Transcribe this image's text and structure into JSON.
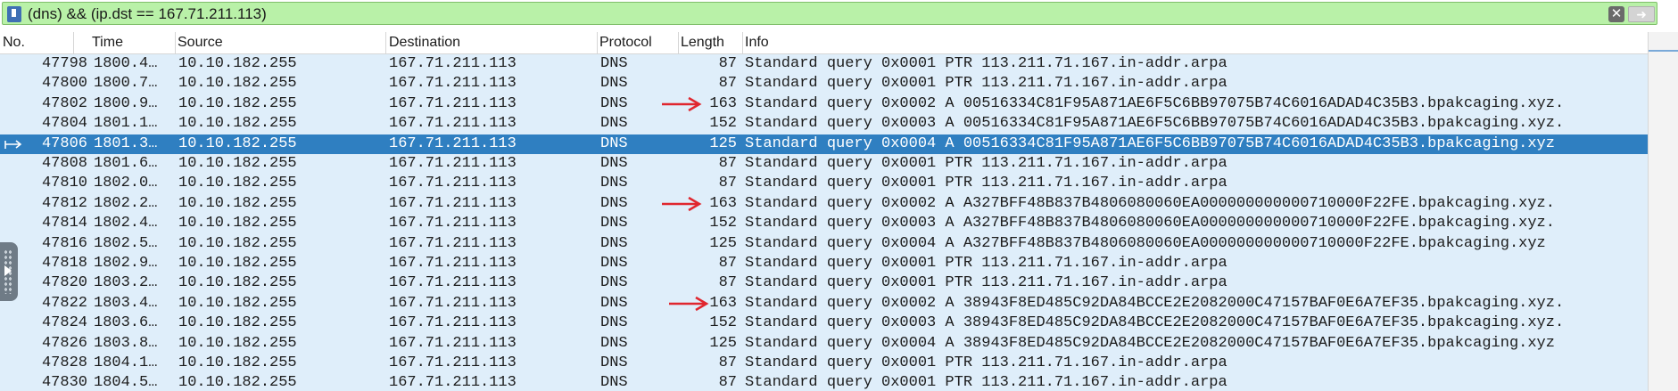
{
  "filter": {
    "expression": "(dns) && (ip.dst == 167.71.211.113)",
    "bookmark_icon": "bookmark-icon",
    "clear_icon": "clear-x-icon",
    "apply_icon": "apply-arrow-icon"
  },
  "columns": [
    "No.",
    "Time",
    "Source",
    "Destination",
    "Protocol",
    "Length",
    "Info"
  ],
  "packets": [
    {
      "no": "47798",
      "time": "1800.4…",
      "src": "10.10.182.255",
      "dst": "167.71.211.113",
      "proto": "DNS",
      "len": "87",
      "info": "Standard query 0x0001 PTR 113.211.71.167.in-addr.arpa"
    },
    {
      "no": "47800",
      "time": "1800.7…",
      "src": "10.10.182.255",
      "dst": "167.71.211.113",
      "proto": "DNS",
      "len": "87",
      "info": "Standard query 0x0001 PTR 113.211.71.167.in-addr.arpa"
    },
    {
      "no": "47802",
      "time": "1800.9…",
      "src": "10.10.182.255",
      "dst": "167.71.211.113",
      "proto": "DNS",
      "len": "163",
      "info": "Standard query 0x0002 A 00516334C81F95A871AE6F5C6BB97075B74C6016ADAD4C35B3.bpakcaging.xyz."
    },
    {
      "no": "47804",
      "time": "1801.1…",
      "src": "10.10.182.255",
      "dst": "167.71.211.113",
      "proto": "DNS",
      "len": "152",
      "info": "Standard query 0x0003 A 00516334C81F95A871AE6F5C6BB97075B74C6016ADAD4C35B3.bpakcaging.xyz."
    },
    {
      "no": "47806",
      "time": "1801.3…",
      "src": "10.10.182.255",
      "dst": "167.71.211.113",
      "proto": "DNS",
      "len": "125",
      "info": "Standard query 0x0004 A 00516334C81F95A871AE6F5C6BB97075B74C6016ADAD4C35B3.bpakcaging.xyz"
    },
    {
      "no": "47808",
      "time": "1801.6…",
      "src": "10.10.182.255",
      "dst": "167.71.211.113",
      "proto": "DNS",
      "len": "87",
      "info": "Standard query 0x0001 PTR 113.211.71.167.in-addr.arpa"
    },
    {
      "no": "47810",
      "time": "1802.0…",
      "src": "10.10.182.255",
      "dst": "167.71.211.113",
      "proto": "DNS",
      "len": "87",
      "info": "Standard query 0x0001 PTR 113.211.71.167.in-addr.arpa"
    },
    {
      "no": "47812",
      "time": "1802.2…",
      "src": "10.10.182.255",
      "dst": "167.71.211.113",
      "proto": "DNS",
      "len": "163",
      "info": "Standard query 0x0002 A A327BFF48B837B4806080060EA000000000000710000F22FE.bpakcaging.xyz."
    },
    {
      "no": "47814",
      "time": "1802.4…",
      "src": "10.10.182.255",
      "dst": "167.71.211.113",
      "proto": "DNS",
      "len": "152",
      "info": "Standard query 0x0003 A A327BFF48B837B4806080060EA000000000000710000F22FE.bpakcaging.xyz."
    },
    {
      "no": "47816",
      "time": "1802.5…",
      "src": "10.10.182.255",
      "dst": "167.71.211.113",
      "proto": "DNS",
      "len": "125",
      "info": "Standard query 0x0004 A A327BFF48B837B4806080060EA000000000000710000F22FE.bpakcaging.xyz"
    },
    {
      "no": "47818",
      "time": "1802.9…",
      "src": "10.10.182.255",
      "dst": "167.71.211.113",
      "proto": "DNS",
      "len": "87",
      "info": "Standard query 0x0001 PTR 113.211.71.167.in-addr.arpa"
    },
    {
      "no": "47820",
      "time": "1803.2…",
      "src": "10.10.182.255",
      "dst": "167.71.211.113",
      "proto": "DNS",
      "len": "87",
      "info": "Standard query 0x0001 PTR 113.211.71.167.in-addr.arpa"
    },
    {
      "no": "47822",
      "time": "1803.4…",
      "src": "10.10.182.255",
      "dst": "167.71.211.113",
      "proto": "DNS",
      "len": "163",
      "info": "Standard query 0x0002 A 38943F8ED485C92DA84BCCE2E2082000C47157BAF0E6A7EF35.bpakcaging.xyz."
    },
    {
      "no": "47824",
      "time": "1803.6…",
      "src": "10.10.182.255",
      "dst": "167.71.211.113",
      "proto": "DNS",
      "len": "152",
      "info": "Standard query 0x0003 A 38943F8ED485C92DA84BCCE2E2082000C47157BAF0E6A7EF35.bpakcaging.xyz."
    },
    {
      "no": "47826",
      "time": "1803.8…",
      "src": "10.10.182.255",
      "dst": "167.71.211.113",
      "proto": "DNS",
      "len": "125",
      "info": "Standard query 0x0004 A 38943F8ED485C92DA84BCCE2E2082000C47157BAF0E6A7EF35.bpakcaging.xyz"
    },
    {
      "no": "47828",
      "time": "1804.1…",
      "src": "10.10.182.255",
      "dst": "167.71.211.113",
      "proto": "DNS",
      "len": "87",
      "info": "Standard query 0x0001 PTR 113.211.71.167.in-addr.arpa"
    },
    {
      "no": "47830",
      "time": "1804.5…",
      "src": "10.10.182.255",
      "dst": "167.71.211.113",
      "proto": "DNS",
      "len": "87",
      "info": "Standard query 0x0001 PTR 113.211.71.167.in-addr.arpa"
    }
  ],
  "selected_packet": "47806",
  "annotated_packets": [
    "47802",
    "47812",
    "47822"
  ],
  "colors": {
    "filter_bg": "#b9f1a8",
    "row_bg": "#dfeefa",
    "selected_bg": "#2f7fc1",
    "annotation_arrow": "#e0262e"
  }
}
